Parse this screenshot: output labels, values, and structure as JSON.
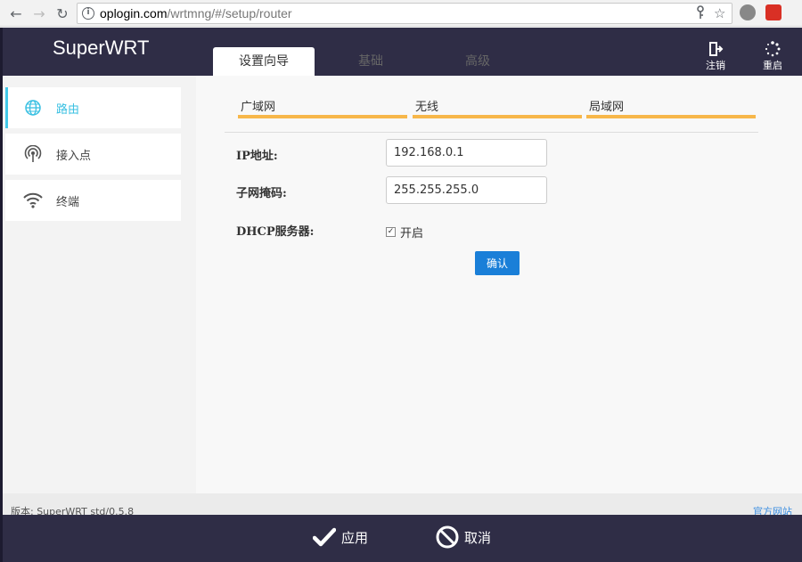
{
  "browser": {
    "url_host": "oplogin.com",
    "url_path": "/wrtmng/#/setup/router",
    "icons": [
      "back-icon",
      "forward-icon",
      "reload-icon",
      "info-icon",
      "key-icon",
      "star-icon",
      "extension-icon",
      "extension-icon"
    ]
  },
  "header": {
    "brand": "SuperWRT",
    "tabs": [
      {
        "label": "设置向导",
        "active": true
      },
      {
        "label": "基础",
        "active": false
      },
      {
        "label": "高级",
        "active": false
      }
    ],
    "logout_label": "注销",
    "reboot_label": "重启"
  },
  "sidebar": {
    "items": [
      {
        "label": "路由",
        "icon": "globe-icon",
        "active": true
      },
      {
        "label": "接入点",
        "icon": "access-point-icon",
        "active": false
      },
      {
        "label": "终端",
        "icon": "wifi-icon",
        "active": false
      }
    ]
  },
  "main": {
    "subtabs": [
      "广域网",
      "无线",
      "局域网"
    ],
    "form": {
      "ip_label": "IP地址:",
      "ip_value": "192.168.0.1",
      "mask_label": "子网掩码:",
      "mask_value": "255.255.255.0",
      "dhcp_label": "DHCP服务器:",
      "dhcp_checkbox_label": "开启",
      "dhcp_checked": true,
      "confirm_label": "确认"
    }
  },
  "footer": {
    "version": "版本: SuperWRT std/0.5.8",
    "official_site": "官方网站",
    "apply_label": "应用",
    "cancel_label": "取消"
  },
  "colors": {
    "header_bg": "#2f2d46",
    "accent_cyan": "#3ac0e2",
    "tab_underline": "#f7b74a",
    "button_blue": "#1a7fd8"
  }
}
